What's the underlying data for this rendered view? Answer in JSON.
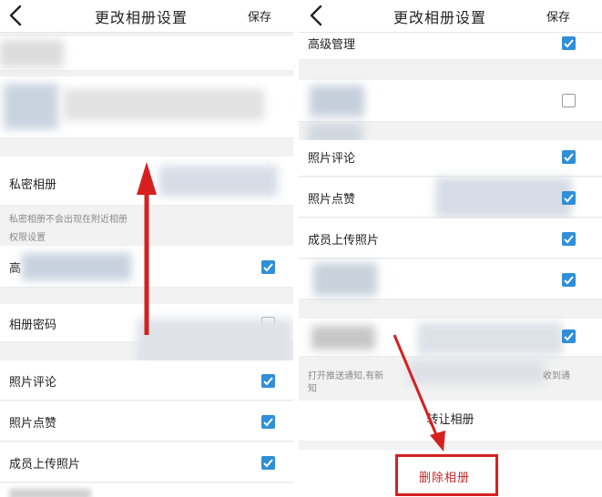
{
  "header": {
    "title": "更改相册设置",
    "save_label": "保存"
  },
  "left_panel": {
    "private_album_label": "私密相册",
    "private_album_desc": "私密相册不会出现在附近相册",
    "permission_label": "权限设置",
    "advanced_label": "高",
    "password_label": "相册密码",
    "password_checked": false,
    "photo_comment_label": "照片评论",
    "photo_comment_checked": true,
    "photo_like_label": "照片点赞",
    "photo_like_checked": true,
    "member_upload_label": "成员上传照片",
    "member_upload_checked": true
  },
  "right_panel": {
    "advanced_manage_label": "高级管理",
    "advanced_manage_checked": true,
    "blurred_row_checked": false,
    "photo_comment_label": "照片评论",
    "photo_comment_checked": true,
    "photo_like_label": "照片点赞",
    "photo_like_checked": true,
    "member_upload_label": "成员上传照片",
    "member_upload_checked": true,
    "blurred_row2_checked": true,
    "blurred_row3_checked": true,
    "push_notice_desc": "打开推送通知,有新",
    "push_notice_desc_end": "收到通",
    "push_notice_desc_line2": "知",
    "transfer_album_label": "转让相册",
    "delete_album_label": "删除相册"
  },
  "colors": {
    "accent": "#2f8fd8",
    "annotation_red": "#d62020"
  },
  "icons": {
    "back": "chevron-left-icon",
    "check": "check-icon"
  }
}
